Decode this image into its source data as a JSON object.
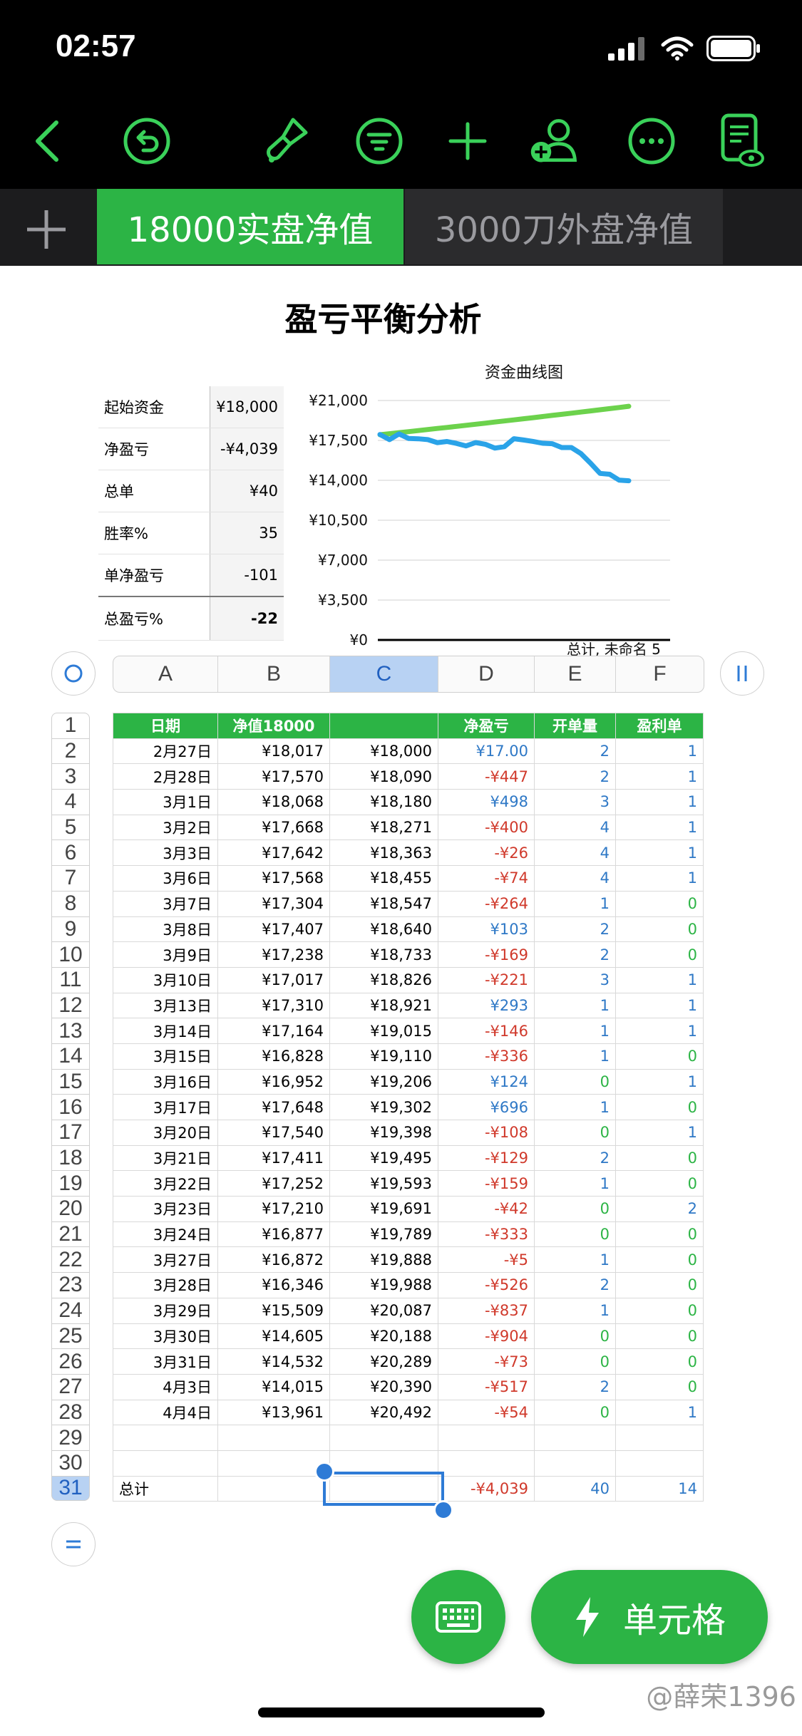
{
  "status": {
    "time": "02:57"
  },
  "tabs": {
    "add": "+",
    "active": "18000实盘净值",
    "inactive": "3000刀外盘净值"
  },
  "sheet_title": "盈亏平衡分析",
  "summary": [
    {
      "label": "起始资金",
      "value": "¥18,000"
    },
    {
      "label": "净盈亏",
      "value": "-¥4,039"
    },
    {
      "label": "总单",
      "value": "¥40"
    },
    {
      "label": "胜率%",
      "value": "35"
    },
    {
      "label": "单净盈亏",
      "value": "-101"
    },
    {
      "label": "总盈亏%",
      "value": "-22"
    }
  ],
  "chart_data": {
    "type": "line",
    "title": "资金曲线图",
    "yticks": [
      "¥21,000",
      "¥17,500",
      "¥14,000",
      "¥10,500",
      "¥7,000",
      "¥3,500",
      "¥0"
    ],
    "ylim": [
      0,
      21000
    ],
    "x_caption_partial": "总计, 未命名 5",
    "series": [
      {
        "color": "#6cd24c",
        "values": [
          18000,
          18090,
          18180,
          18271,
          18363,
          18455,
          18547,
          18640,
          18733,
          18826,
          18921,
          19015,
          19110,
          19206,
          19302,
          19398,
          19495,
          19593,
          19691,
          19789,
          19888,
          19988,
          20087,
          20188,
          20289,
          20390,
          20492
        ]
      },
      {
        "color": "#2aa3e8",
        "values": [
          18017,
          17570,
          18068,
          17668,
          17642,
          17568,
          17304,
          17407,
          17238,
          17017,
          17310,
          17164,
          16828,
          16952,
          17648,
          17540,
          17411,
          17252,
          17210,
          16877,
          16872,
          16346,
          15509,
          14605,
          14532,
          14015,
          13961
        ]
      }
    ]
  },
  "columns": [
    "A",
    "B",
    "C",
    "D",
    "E",
    "F"
  ],
  "row_numbers": [
    "1",
    "2",
    "3",
    "4",
    "5",
    "6",
    "7",
    "8",
    "9",
    "10",
    "11",
    "12",
    "13",
    "14",
    "15",
    "16",
    "17",
    "18",
    "19",
    "20",
    "21",
    "22",
    "23",
    "24",
    "25",
    "26",
    "27",
    "28",
    "29",
    "30",
    "31"
  ],
  "header": [
    "日期",
    "净值18000",
    "",
    "净盈亏",
    "开单量",
    "盈利单"
  ],
  "rows": [
    [
      "2月27日",
      "¥18,017",
      "¥18,000",
      "¥17.00",
      "2",
      "1"
    ],
    [
      "2月28日",
      "¥17,570",
      "¥18,090",
      "-¥447",
      "2",
      "1"
    ],
    [
      "3月1日",
      "¥18,068",
      "¥18,180",
      "¥498",
      "3",
      "1"
    ],
    [
      "3月2日",
      "¥17,668",
      "¥18,271",
      "-¥400",
      "4",
      "1"
    ],
    [
      "3月3日",
      "¥17,642",
      "¥18,363",
      "-¥26",
      "4",
      "1"
    ],
    [
      "3月6日",
      "¥17,568",
      "¥18,455",
      "-¥74",
      "4",
      "1"
    ],
    [
      "3月7日",
      "¥17,304",
      "¥18,547",
      "-¥264",
      "1",
      "0"
    ],
    [
      "3月8日",
      "¥17,407",
      "¥18,640",
      "¥103",
      "2",
      "0"
    ],
    [
      "3月9日",
      "¥17,238",
      "¥18,733",
      "-¥169",
      "2",
      "0"
    ],
    [
      "3月10日",
      "¥17,017",
      "¥18,826",
      "-¥221",
      "3",
      "1"
    ],
    [
      "3月13日",
      "¥17,310",
      "¥18,921",
      "¥293",
      "1",
      "1"
    ],
    [
      "3月14日",
      "¥17,164",
      "¥19,015",
      "-¥146",
      "1",
      "1"
    ],
    [
      "3月15日",
      "¥16,828",
      "¥19,110",
      "-¥336",
      "1",
      "0"
    ],
    [
      "3月16日",
      "¥16,952",
      "¥19,206",
      "¥124",
      "0",
      "1"
    ],
    [
      "3月17日",
      "¥17,648",
      "¥19,302",
      "¥696",
      "1",
      "0"
    ],
    [
      "3月20日",
      "¥17,540",
      "¥19,398",
      "-¥108",
      "0",
      "1"
    ],
    [
      "3月21日",
      "¥17,411",
      "¥19,495",
      "-¥129",
      "2",
      "0"
    ],
    [
      "3月22日",
      "¥17,252",
      "¥19,593",
      "-¥159",
      "1",
      "0"
    ],
    [
      "3月23日",
      "¥17,210",
      "¥19,691",
      "-¥42",
      "0",
      "2"
    ],
    [
      "3月24日",
      "¥16,877",
      "¥19,789",
      "-¥333",
      "0",
      "0"
    ],
    [
      "3月27日",
      "¥16,872",
      "¥19,888",
      "-¥5",
      "1",
      "0"
    ],
    [
      "3月28日",
      "¥16,346",
      "¥19,988",
      "-¥526",
      "2",
      "0"
    ],
    [
      "3月29日",
      "¥15,509",
      "¥20,087",
      "-¥837",
      "1",
      "0"
    ],
    [
      "3月30日",
      "¥14,605",
      "¥20,188",
      "-¥904",
      "0",
      "0"
    ],
    [
      "3月31日",
      "¥14,532",
      "¥20,289",
      "-¥73",
      "0",
      "0"
    ],
    [
      "4月3日",
      "¥14,015",
      "¥20,390",
      "-¥517",
      "2",
      "0"
    ],
    [
      "4月4日",
      "¥13,961",
      "¥20,492",
      "-¥54",
      "0",
      "1"
    ],
    [
      "",
      "",
      "",
      "",
      "",
      ""
    ],
    [
      "",
      "",
      "",
      "",
      "",
      ""
    ]
  ],
  "total_row": [
    "总计",
    "",
    "",
    "-¥4,039",
    "40",
    "14"
  ],
  "fab": {
    "cell_label": "单元格"
  },
  "watermark": "@薛荣1396",
  "colors": {
    "accent": "#2cb445",
    "negative": "#d0392b",
    "positive": "#2e78c6",
    "selection": "#b8d2f3"
  }
}
